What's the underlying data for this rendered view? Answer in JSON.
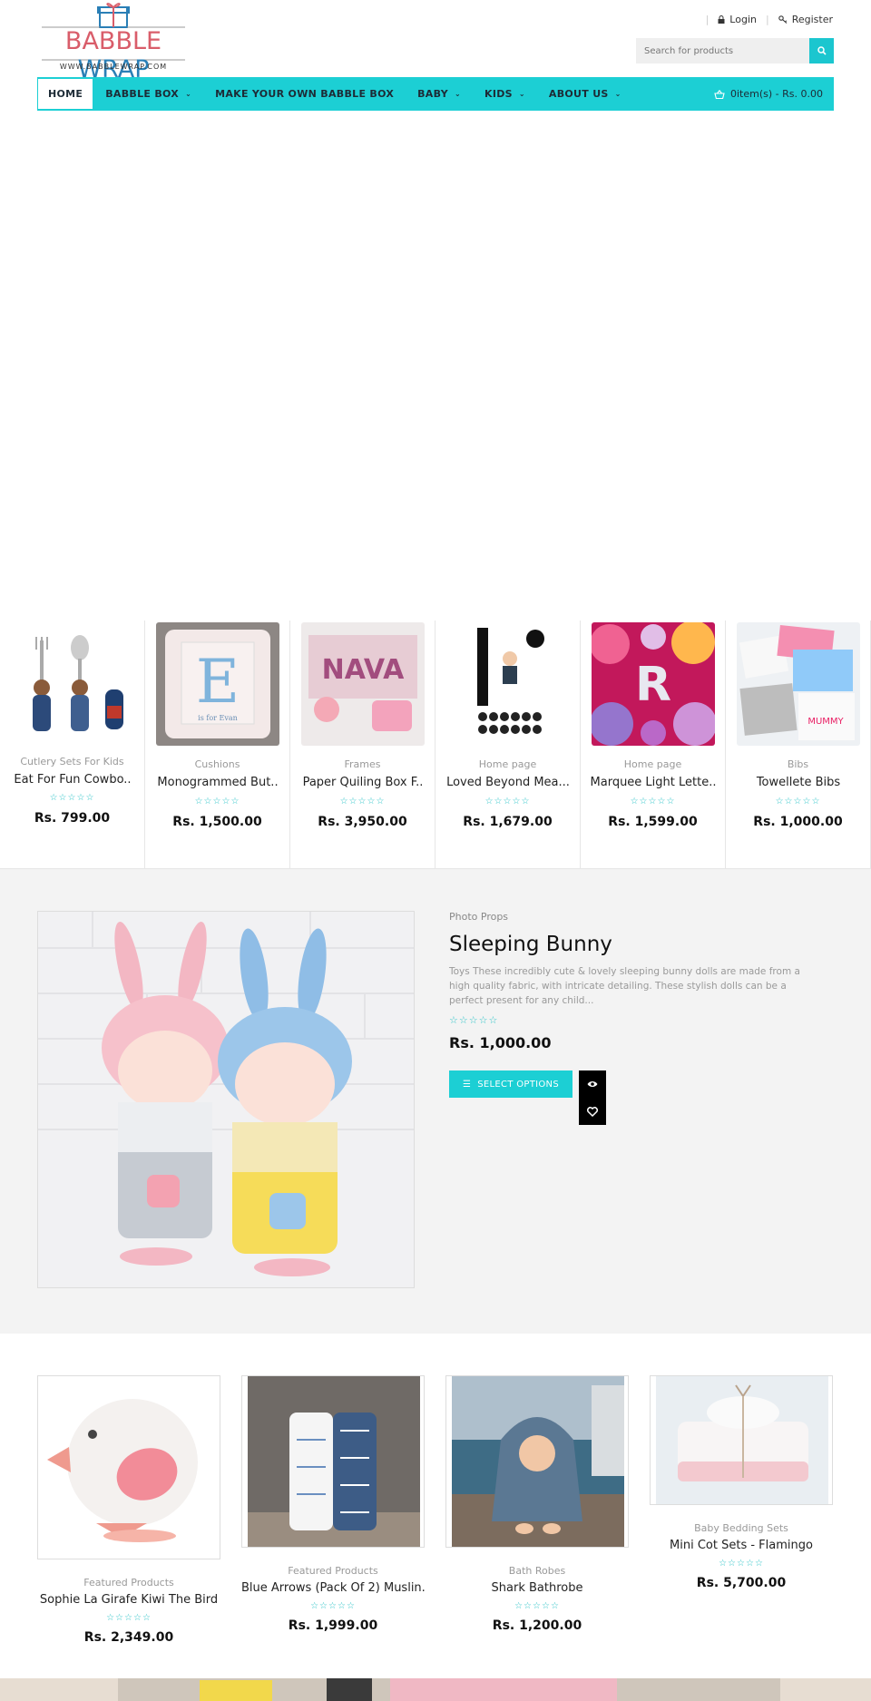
{
  "header": {
    "logo_main_left": "BABBLE",
    "logo_main_right": "WRAP",
    "logo_sub": "WWW.BABBLEWRAP.COM",
    "login_label": "Login",
    "register_label": "Register",
    "search_placeholder": "Search for products"
  },
  "nav": {
    "items": [
      {
        "label": "HOME"
      },
      {
        "label": "BABBLE BOX"
      },
      {
        "label": "MAKE YOUR OWN BABBLE BOX"
      },
      {
        "label": "BABY"
      },
      {
        "label": "KIDS"
      },
      {
        "label": "ABOUT US"
      }
    ],
    "cart_label": "0item(s) - Rs. 0.00"
  },
  "strip": [
    {
      "category": "Cutlery Sets For Kids",
      "name": "Eat For Fun Cowbo..",
      "stars": "☆☆☆☆☆",
      "price": "Rs. 799.00"
    },
    {
      "category": "Cushions",
      "name": "Monogrammed But..",
      "stars": "☆☆☆☆☆",
      "price": "Rs. 1,500.00"
    },
    {
      "category": "Frames",
      "name": "Paper Quiling Box F..",
      "stars": "☆☆☆☆☆",
      "price": "Rs. 3,950.00"
    },
    {
      "category": "Home page",
      "name": "Loved Beyond Mea...",
      "stars": "☆☆☆☆☆",
      "price": "Rs. 1,679.00"
    },
    {
      "category": "Home page",
      "name": "Marquee Light Lette..",
      "stars": "☆☆☆☆☆",
      "price": "Rs. 1,599.00"
    },
    {
      "category": "Bibs",
      "name": "Towellete Bibs",
      "stars": "☆☆☆☆☆",
      "price": "Rs. 1,000.00"
    }
  ],
  "featured": {
    "category": "Photo Props",
    "title": "Sleeping Bunny",
    "description": "Toys These incredibly cute & lovely sleeping bunny dolls are made from a high quality fabric, with intricate detailing. These stylish dolls can be a perfect present for any child...",
    "stars": "☆☆☆☆☆",
    "price": "Rs. 1,000.00",
    "button_label": "SELECT OPTIONS"
  },
  "grid": [
    {
      "category": "Featured Products",
      "name": "Sophie La Girafe Kiwi The Bird",
      "stars": "☆☆☆☆☆",
      "price": "Rs. 2,349.00"
    },
    {
      "category": "Featured Products",
      "name": "Blue Arrows (Pack Of 2) Muslin.",
      "stars": "☆☆☆☆☆",
      "price": "Rs. 1,999.00"
    },
    {
      "category": "Bath Robes",
      "name": "Shark Bathrobe",
      "stars": "☆☆☆☆☆",
      "price": "Rs. 1,200.00"
    },
    {
      "category": "Baby Bedding Sets",
      "name": "Mini Cot Sets - Flamingo",
      "stars": "☆☆☆☆☆",
      "price": "Rs. 5,700.00"
    }
  ],
  "colors": {
    "accent": "#1ccfd4",
    "logo_pink": "#d95d6a",
    "logo_blue": "#2a7fb6"
  }
}
